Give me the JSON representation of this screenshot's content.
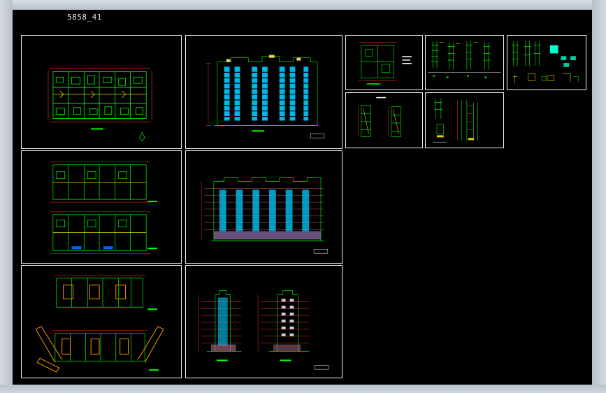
{
  "drawing": {
    "title": "5858_41"
  },
  "sheets": [
    {
      "id": "floor-plan-1",
      "kind": "floor-plan"
    },
    {
      "id": "front-elevation",
      "kind": "elevation"
    },
    {
      "id": "unit-plan",
      "kind": "detail"
    },
    {
      "id": "wall-sections",
      "kind": "detail"
    },
    {
      "id": "detail-set",
      "kind": "detail"
    },
    {
      "id": "floor-plans-2",
      "kind": "floor-plan"
    },
    {
      "id": "rear-elevation",
      "kind": "elevation"
    },
    {
      "id": "stair-details",
      "kind": "detail"
    },
    {
      "id": "section-detail",
      "kind": "detail"
    },
    {
      "id": "floor-plans-3",
      "kind": "floor-plan"
    },
    {
      "id": "side-elevations",
      "kind": "elevation"
    }
  ],
  "colors": {
    "background": "#000000",
    "sheet_border": "#ffffff",
    "walls": "#00ff00",
    "dimensions": "#ff3333",
    "accent": "#ffff00",
    "windows": "#00ccff",
    "text": "#ffffff"
  }
}
